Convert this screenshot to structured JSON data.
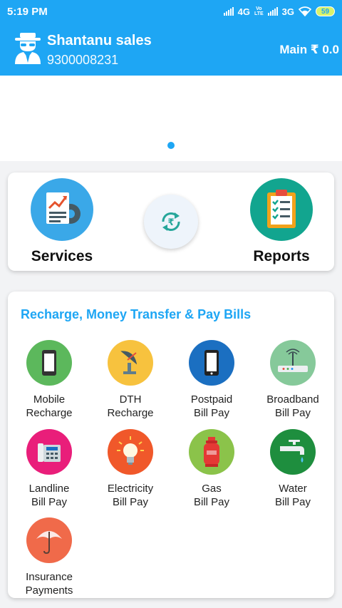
{
  "status_bar": {
    "time": "5:19 PM",
    "net1": "4G",
    "volte_top": "Vo",
    "volte_bottom": "LTE",
    "net2": "3G",
    "battery": "59"
  },
  "header": {
    "name": "Shantanu sales",
    "phone": "9300008231",
    "balance": "Main ₹ 0.0"
  },
  "quick_actions": {
    "services_label": "Services",
    "reports_label": "Reports"
  },
  "section": {
    "title": "Recharge, Money Transfer & Pay Bills"
  },
  "services": [
    {
      "line1": "Mobile",
      "line2": "Recharge"
    },
    {
      "line1": "DTH",
      "line2": "Recharge"
    },
    {
      "line1": "Postpaid",
      "line2": "Bill Pay"
    },
    {
      "line1": "Broadband",
      "line2": "Bill Pay"
    },
    {
      "line1": "Landline",
      "line2": "Bill Pay"
    },
    {
      "line1": "Electricity",
      "line2": "Bill Pay"
    },
    {
      "line1": "Gas",
      "line2": "Bill Pay"
    },
    {
      "line1": "Water",
      "line2": "Bill Pay"
    },
    {
      "line1": "Insurance",
      "line2": "Payments"
    }
  ],
  "colors": {
    "brand_blue": "#1ea6f4",
    "mobile": "#5cb85c",
    "dth": "#f7c23e",
    "postpaid": "#1b6fc1",
    "broadband": "#86c99a",
    "landline": "#e91e7a",
    "electricity": "#f0582a",
    "gas": "#8bc34a",
    "water": "#1e8e3e",
    "insurance": "#f06a4a"
  },
  "icons": [
    "spy-avatar-icon",
    "services-icon",
    "reports-clipboard-icon",
    "rupee-refresh-icon",
    "mobile-icon",
    "satellite-dish-icon",
    "postpaid-phone-icon",
    "router-icon",
    "landline-phone-icon",
    "bulb-icon",
    "gas-cylinder-icon",
    "water-tap-icon",
    "umbrella-icon"
  ]
}
